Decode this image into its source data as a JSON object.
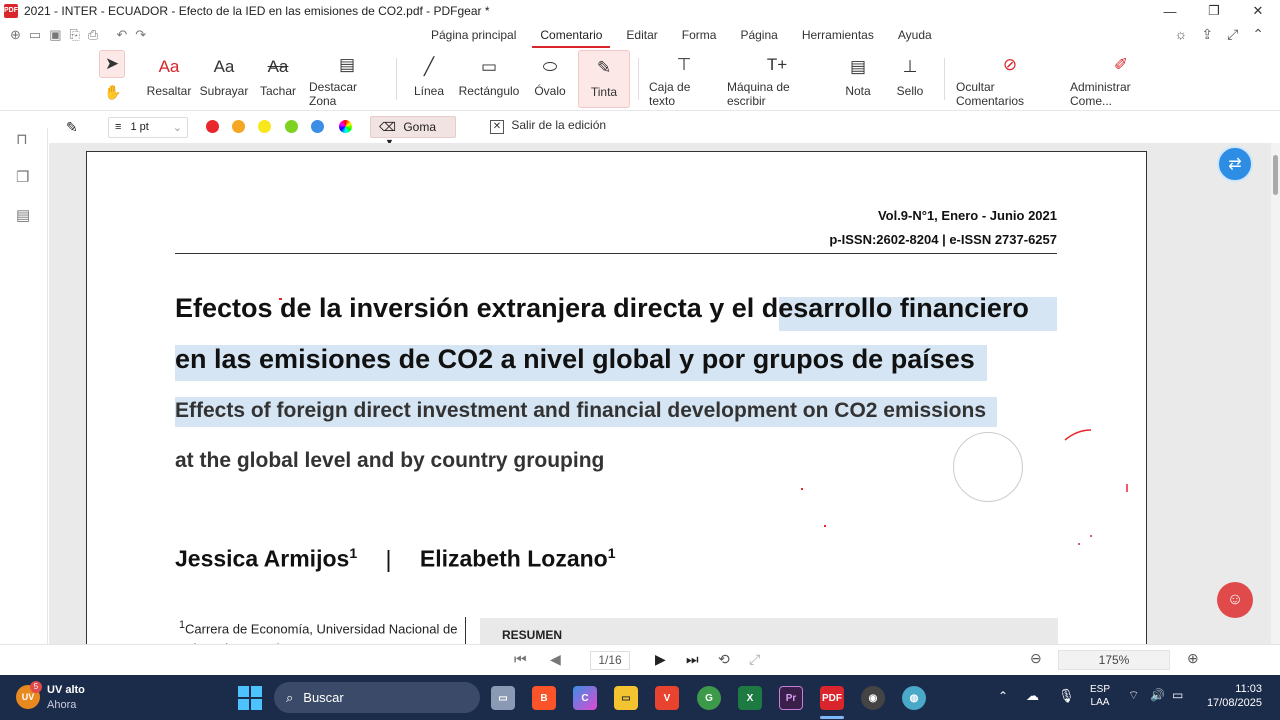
{
  "window": {
    "title": "2021 - INTER - ECUADOR - Efecto de la IED en las emisiones de CO2.pdf - PDFgear *",
    "app_badge": "PDF",
    "minimize": "—",
    "maximize": "❐",
    "close": "✕"
  },
  "menu": {
    "tabs": [
      "Página principal",
      "Comentario",
      "Editar",
      "Forma",
      "Página",
      "Herramientas",
      "Ayuda"
    ]
  },
  "ribbon": {
    "resaltar": "Resaltar",
    "subrayar": "Subrayar",
    "tachar": "Tachar",
    "destacar_zona": "Destacar Zona",
    "linea": "Línea",
    "rectangulo": "Rectángulo",
    "ovalo": "Óvalo",
    "tinta": "Tinta",
    "caja_texto": "Caja de texto",
    "maquina": "Máquina de escribir",
    "nota": "Nota",
    "sello": "Sello",
    "ocultar": "Ocultar Comentarios",
    "administrar": "Administrar Come..."
  },
  "subbar": {
    "thickness": "1 pt",
    "eraser": "Goma",
    "exit_edit": "Salir de la edición",
    "colors": [
      "#e8272d",
      "#f5a623",
      "#f8e71c",
      "#7ed321",
      "#3a8ee6"
    ]
  },
  "document": {
    "vol": "Vol.9-N°1, Enero - Junio 2021",
    "issn": "p-ISSN:2602-8204 | e-ISSN 2737-6257",
    "title_es_1": "Efectos de la inversión extranjera directa y el desarrollo financiero",
    "title_es_2": "en las emisiones de CO2 a nivel global y por grupos de países",
    "title_en_1": "Effects of foreign direct investment and financial development on CO2 emissions",
    "title_en_2": "at the global level and by country grouping",
    "author1": "Jessica Armijos",
    "author2": "Elizabeth Lozano",
    "sup": "1",
    "separator": "|",
    "affiliation": "Carrera de Economía, Universidad Nacional de Loja, Loja, Ecuador",
    "resumen": "RESUMEN"
  },
  "nav": {
    "page": "1/16",
    "zoom": "175%"
  },
  "taskbar": {
    "weather_temp": "UV alto",
    "weather_sub": "Ahora",
    "search": "Buscar",
    "lang1": "ESP",
    "lang2": "LAA",
    "time": "11:03",
    "date": "17/08/2025",
    "badge": "5"
  }
}
